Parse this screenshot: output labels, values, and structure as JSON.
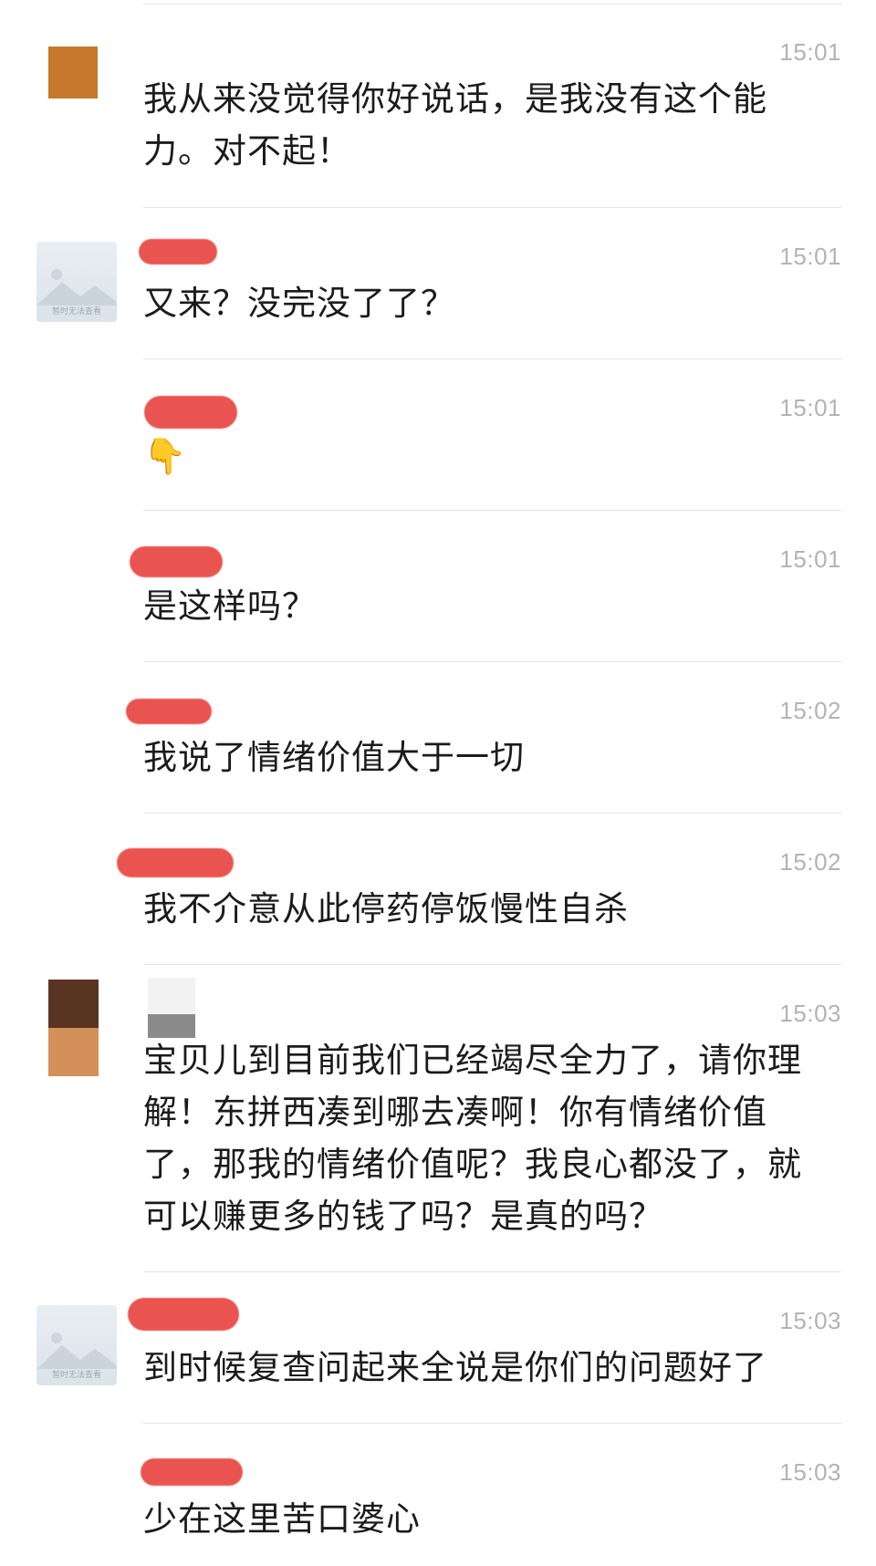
{
  "colors": {
    "background": "#ffffff",
    "divider": "#e4e4e4",
    "timestamp": "#b3b3b3",
    "message_text": "#1b1b1b",
    "redaction": "#ea5450",
    "avatar_orange": "#c6782c",
    "avatar_brown_dark": "#5a3422",
    "avatar_brown_light": "#d39058"
  },
  "messages": [
    {
      "time": "15:01",
      "text_lines": [
        "我从来没觉得你好说话，是我没有这个能",
        "力。对不起！"
      ],
      "avatar": "orange-square"
    },
    {
      "time": "15:01",
      "text_lines": [
        "又来？没完没了了？"
      ],
      "avatar": "image-unavailable",
      "avatar_caption": "暂时无法查看"
    },
    {
      "time": "15:01",
      "emoji": "👇",
      "avatar": "none"
    },
    {
      "time": "15:01",
      "text_lines": [
        "是这样吗？"
      ],
      "avatar": "none"
    },
    {
      "time": "15:02",
      "text_lines": [
        "我说了情绪价值大于一切"
      ],
      "avatar": "none"
    },
    {
      "time": "15:02",
      "text_lines": [
        "我不介意从此停药停饭慢性自杀"
      ],
      "avatar": "none"
    },
    {
      "time": "15:03",
      "text_lines": [
        "宝贝儿到目前我们已经竭尽全力了，请你理",
        "解！东拼西凑到哪去凑啊！你有情绪价值",
        "了，那我的情绪价值呢？我良心都没了，就",
        "可以赚更多的钱了吗？是真的吗？"
      ],
      "avatar": "brown-square"
    },
    {
      "time": "15:03",
      "text_lines": [
        "到时候复查问起来全说是你们的问题好了"
      ],
      "avatar": "image-unavailable",
      "avatar_caption": "暂时无法查看"
    },
    {
      "time": "15:03",
      "text_lines": [
        "少在这里苦口婆心"
      ],
      "avatar": "none"
    }
  ]
}
